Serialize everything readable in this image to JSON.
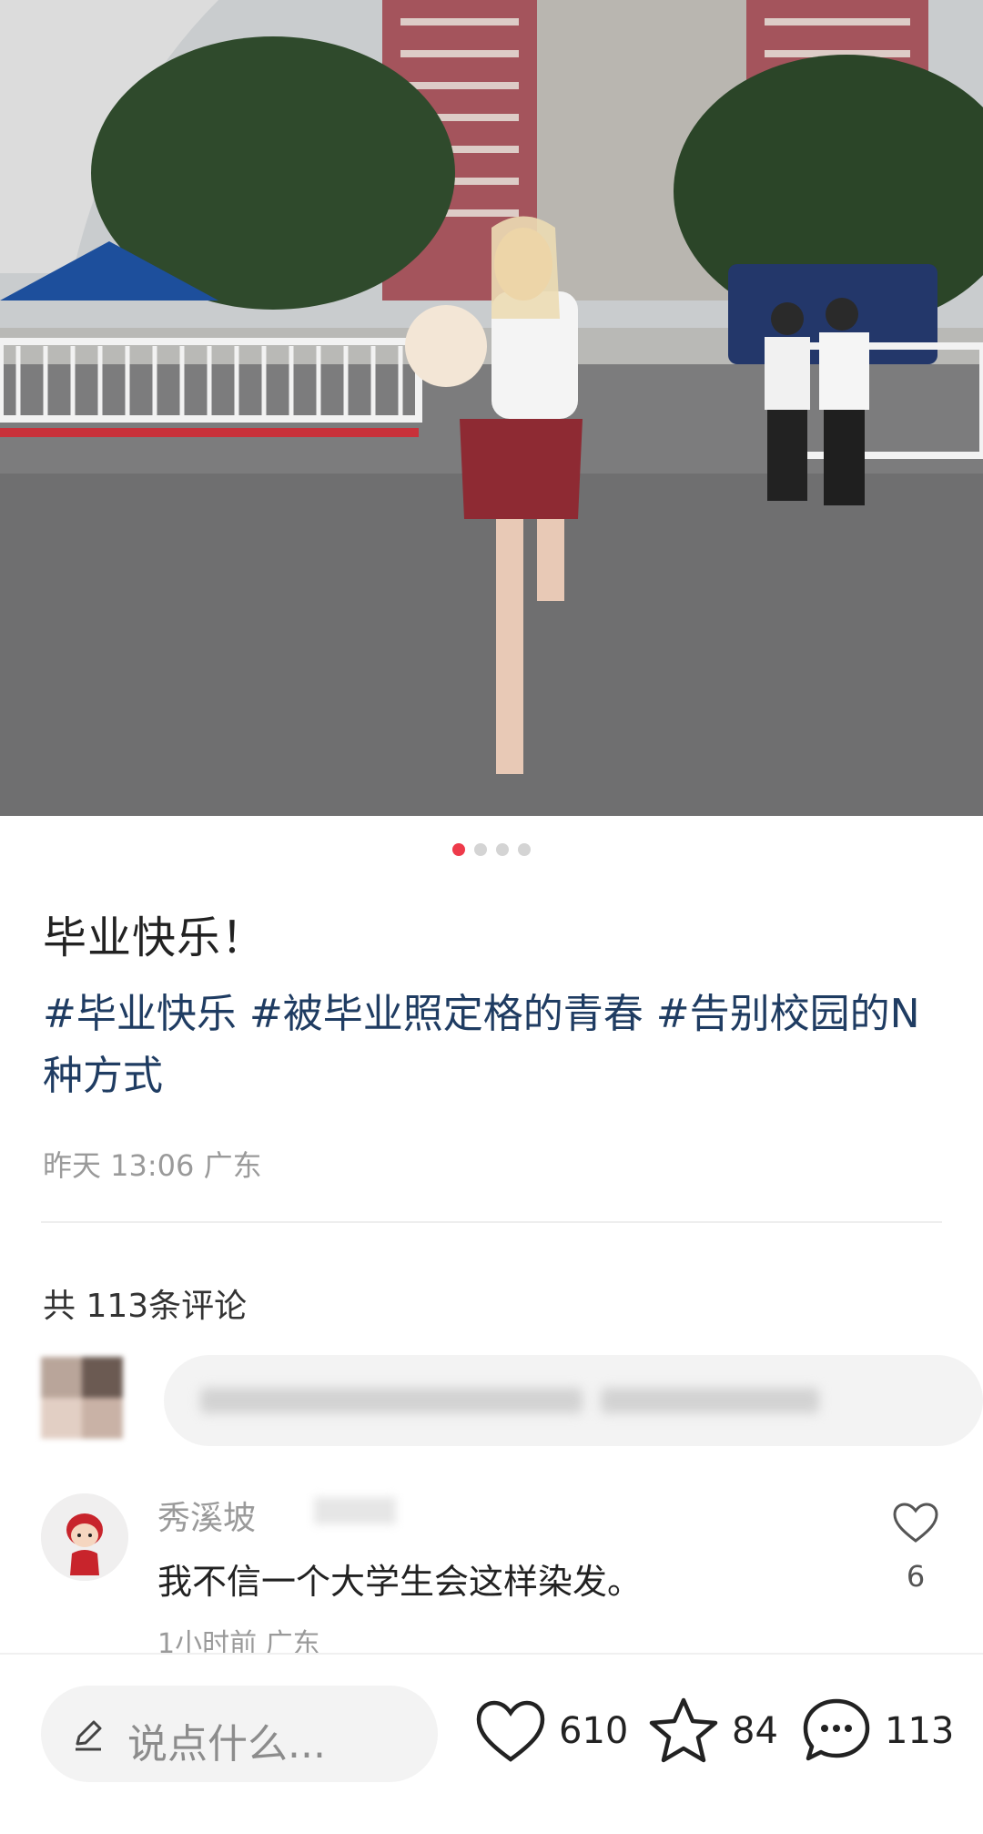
{
  "post": {
    "image_pages": 4,
    "current_page": 1,
    "title": "毕业快乐！",
    "tags": [
      "#毕业快乐",
      "#被毕业照定格的青春",
      "#告别校园的N种方式"
    ],
    "time": "昨天 13:06",
    "location": "广东"
  },
  "comments": {
    "count_label": "共 113条评论",
    "list": [
      {
        "user": "秀溪坡",
        "text": "我不信一个大学生会这样染发。",
        "time": "1小时前",
        "location": "广东",
        "likes": "6"
      }
    ]
  },
  "bottom_bar": {
    "input_placeholder": "说点什么...",
    "likes": "610",
    "favorites": "84",
    "comments": "113"
  },
  "colors": {
    "accent": "#ee3a4a",
    "tag": "#1f3c62",
    "secondary_text": "#9a9a9a"
  },
  "icons": [
    "pencil-icon",
    "heart-icon",
    "star-icon",
    "comment-bubble-icon"
  ]
}
